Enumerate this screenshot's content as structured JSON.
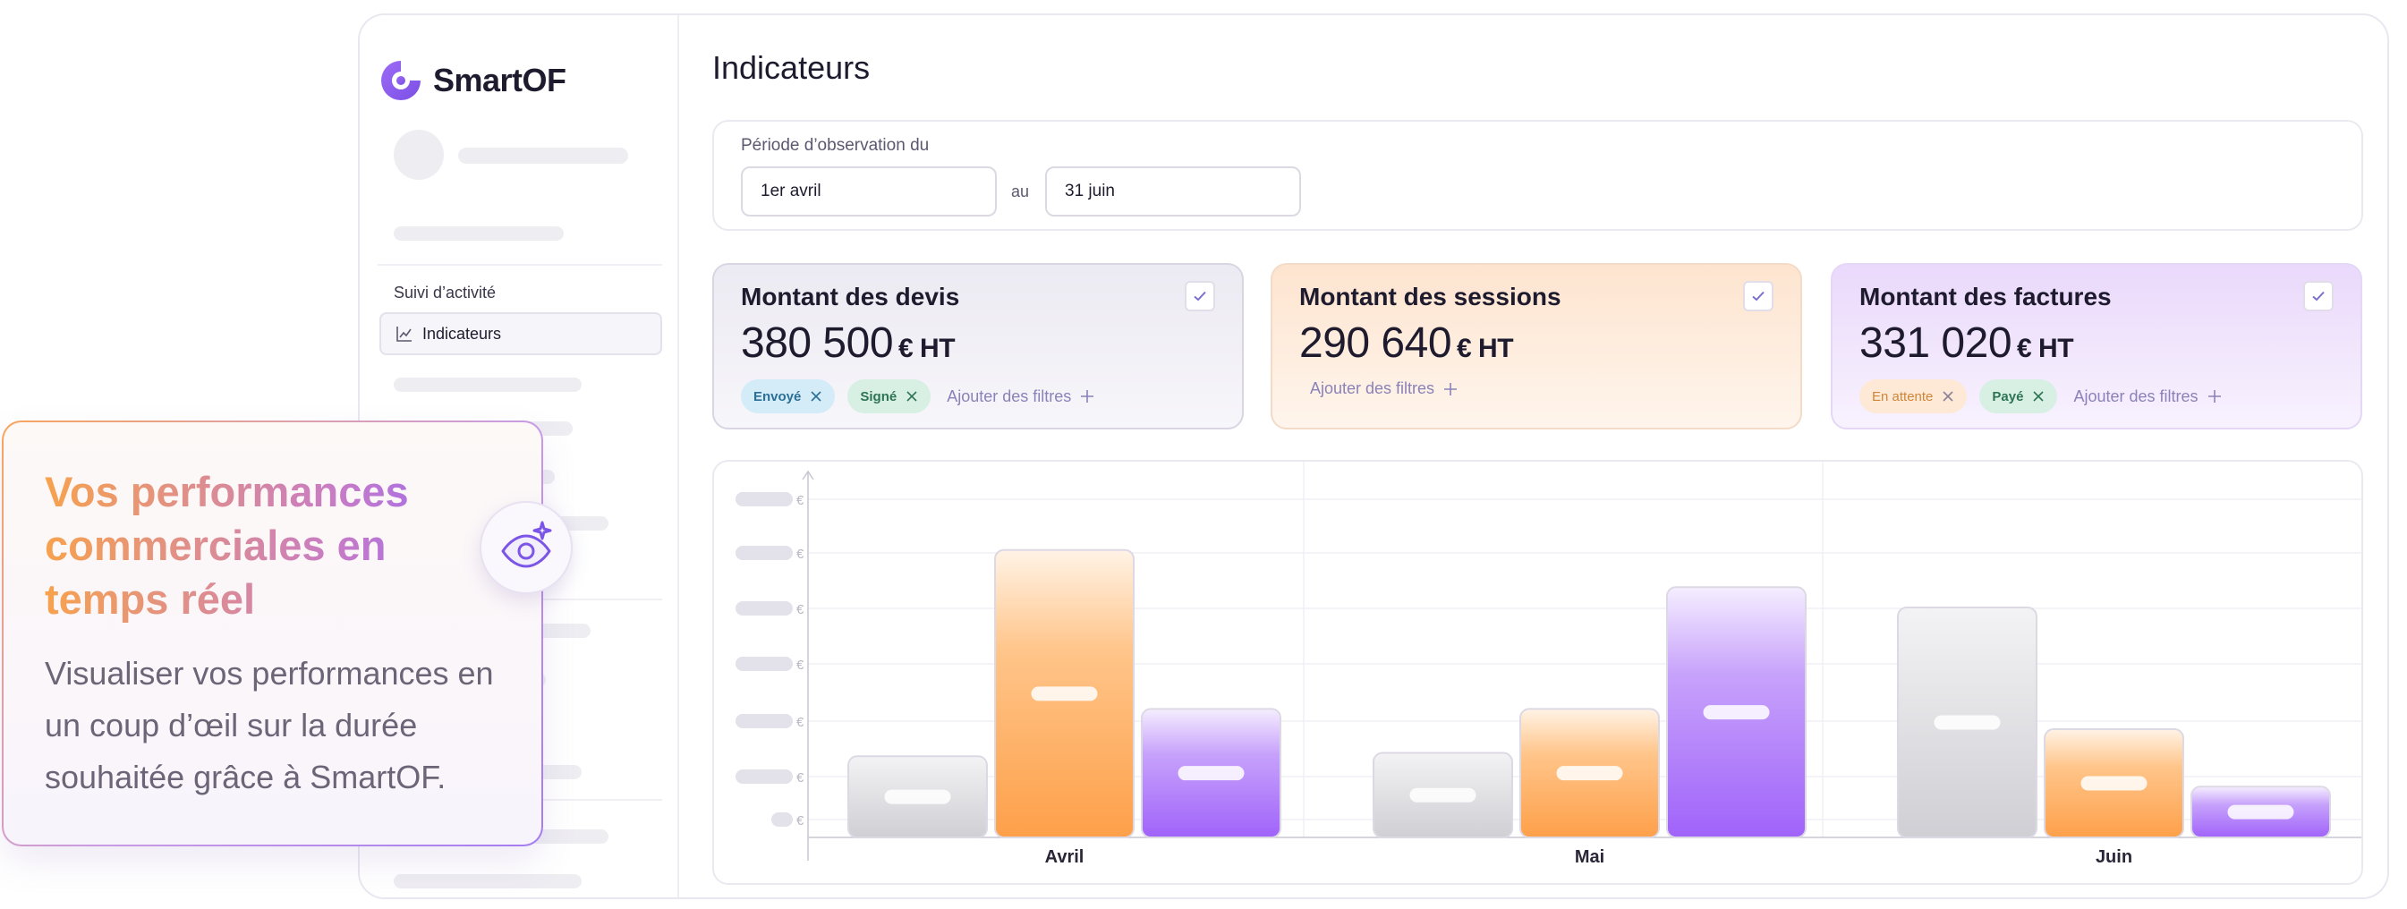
{
  "app": {
    "name": "SmartOF"
  },
  "sidebar": {
    "section_label": "Suivi d’activité",
    "items": [
      {
        "label": "Indicateurs",
        "icon": "chart-line-icon"
      }
    ]
  },
  "page": {
    "title": "Indicateurs"
  },
  "period": {
    "label": "Période d’observation du",
    "from": "1er avril",
    "separator": "au",
    "to": "31 juin"
  },
  "kpis": [
    {
      "title": "Montant des devis",
      "value": "380 500",
      "unit": "€ HT",
      "checked": true,
      "filters": [
        {
          "label": "Envoyé",
          "color": "#d4ecf8"
        },
        {
          "label": "Signé",
          "color": "#d8efe4"
        }
      ],
      "add_filter_label": "Ajouter des filtres"
    },
    {
      "title": "Montant des sessions",
      "value": "290 640",
      "unit": "€ HT",
      "checked": true,
      "filters": [],
      "add_filter_label": "Ajouter des filtres"
    },
    {
      "title": "Montant des factures",
      "value": "331 020",
      "unit": "€ HT",
      "checked": true,
      "filters": [
        {
          "label": "En attente",
          "color": "#fde9d6"
        },
        {
          "label": "Payé",
          "color": "#d8efe4"
        }
      ],
      "add_filter_label": "Ajouter des filtres"
    }
  ],
  "chart_data": {
    "type": "bar",
    "categories": [
      "Avril",
      "Mai",
      "Juin"
    ],
    "y_tick_unit": "€",
    "y_tick_count": 7,
    "grid": true,
    "legend": "none",
    "ylim": [
      0,
      100
    ],
    "series": [
      {
        "color": "#d4d4d8",
        "values": [
          24,
          25,
          68
        ]
      },
      {
        "color": "#fea54c",
        "values": [
          85,
          38,
          32
        ]
      },
      {
        "color": "#a56bfa",
        "values": [
          38,
          74,
          15
        ]
      }
    ]
  },
  "callout": {
    "title": "Vos performances commerciales en temps réel",
    "text": "Visualiser vos performances en un coup d’œil sur la durée souhaitée grâce à SmartOF.",
    "icon": "eye-sparkle-icon"
  },
  "colors": {
    "accent": "#8b5cf6",
    "orange": "#fea54c",
    "purple": "#a56bfa"
  }
}
